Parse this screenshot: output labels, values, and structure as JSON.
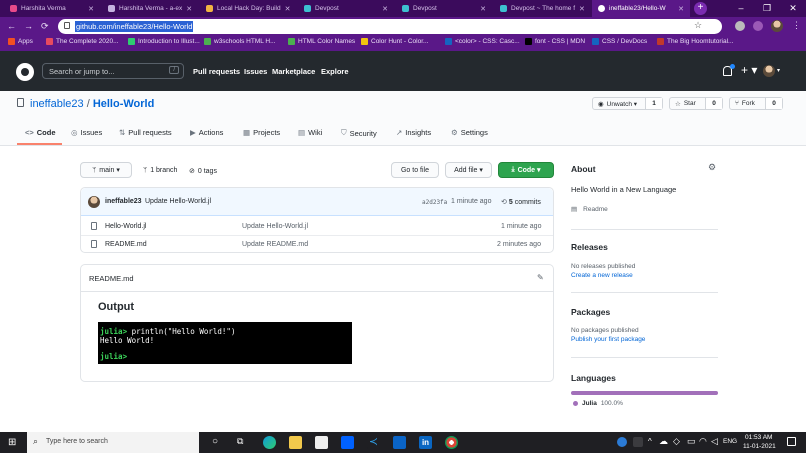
{
  "browser": {
    "tabs": [
      {
        "label": "Harshita Verma",
        "color": "#e84a8a"
      },
      {
        "label": "Harshita Verma - a-ex",
        "color": "#c6b3e0"
      },
      {
        "label": "Local Hack Day: Build",
        "color": "#f1b443"
      },
      {
        "label": "Devpost",
        "color": "#3dc0d0"
      },
      {
        "label": "Devpost",
        "color": "#3dc0d0"
      },
      {
        "label": "Devpost ~ The home f",
        "color": "#3dc0d0"
      },
      {
        "label": "ineffable23/Hello-W",
        "color": "#ffffff"
      }
    ],
    "window_controls": [
      "–",
      "❐",
      "✕"
    ],
    "nav": {
      "back": "←",
      "forward": "→",
      "reload": "⟳"
    },
    "url": "github.com/ineffable23/Hello-World",
    "bookmarks": [
      {
        "label": "Apps",
        "color": "#f25022"
      },
      {
        "label": "The Complete 2020...",
        "color": "#e84a5f"
      },
      {
        "label": "Introduction to Illust...",
        "color": "#2ecc71"
      },
      {
        "label": "w3schools HTML H...",
        "color": "#4caf50"
      },
      {
        "label": "HTML Color Names",
        "color": "#4caf50"
      },
      {
        "label": "Color Hunt - Color...",
        "color": "#f1c40f"
      },
      {
        "label": "<color> - CSS: Casc...",
        "color": "#1565c0"
      },
      {
        "label": "font - CSS | MDN",
        "color": "#000000"
      },
      {
        "label": "CSS / DevDocs",
        "color": "#1565c0"
      },
      {
        "label": "The Big Hoomtutorial...",
        "color": "#c0392b"
      }
    ]
  },
  "github": {
    "search_placeholder": "Search or jump to...",
    "search_key": "/",
    "nav": [
      "Pull requests",
      "Issues",
      "Marketplace",
      "Explore"
    ],
    "plus": "+ ▾",
    "owner": "ineffable23",
    "separator": "/",
    "repo": "Hello-World",
    "watch": {
      "label": "Unwatch ▾",
      "count": "1"
    },
    "star": {
      "label": "Star",
      "count": "0"
    },
    "fork": {
      "label": "Fork",
      "count": "0"
    },
    "tabs": [
      {
        "label": "Code",
        "icon": "<>"
      },
      {
        "label": "Issues",
        "icon": "◎"
      },
      {
        "label": "Pull requests",
        "icon": "⇅"
      },
      {
        "label": "Actions",
        "icon": "▶"
      },
      {
        "label": "Projects",
        "icon": "▦"
      },
      {
        "label": "Wiki",
        "icon": "▤"
      },
      {
        "label": "Security",
        "icon": "⛉"
      },
      {
        "label": "Insights",
        "icon": "↗"
      },
      {
        "label": "Settings",
        "icon": "⚙"
      }
    ],
    "branch": "main ▾",
    "branch_count": "1 branch",
    "tags": "0 tags",
    "go_to_file": "Go to file",
    "add_file": "Add file ▾",
    "code_button": "Code ▾",
    "last_commit": {
      "author": "ineffable23",
      "message": "Update Hello-World.jl",
      "hash": "a2d23fa",
      "time": "1 minute ago",
      "commits_count": "5",
      "commits_label": "commits"
    },
    "files": [
      {
        "name": "Hello-World.jl",
        "message": "Update Hello-World.jl",
        "time": "1 minute ago"
      },
      {
        "name": "README.md",
        "message": "Update README.md",
        "time": "2 minutes ago"
      }
    ],
    "readme": {
      "filename": "README.md",
      "heading": "Output",
      "terminal": {
        "prompt1": "julia>",
        "command": " println(\"Hello World!\")",
        "output": "Hello World!",
        "prompt2": "julia>"
      }
    },
    "sidebar": {
      "about_title": "About",
      "description": "Hello World in a New Language",
      "readme_link": "Readme",
      "releases_title": "Releases",
      "releases_text": "No releases published",
      "releases_link": "Create a new release",
      "packages_title": "Packages",
      "packages_text": "No packages published",
      "packages_link": "Publish your first package",
      "languages_title": "Languages",
      "language": "Julia",
      "language_pct": "100.0%",
      "language_fraction": 1.0,
      "language_color": "#a270ba"
    }
  },
  "taskbar": {
    "search_placeholder": "Type here to search",
    "lang": "ENG",
    "time": "01:53 AM",
    "date": "11-01-2021"
  }
}
